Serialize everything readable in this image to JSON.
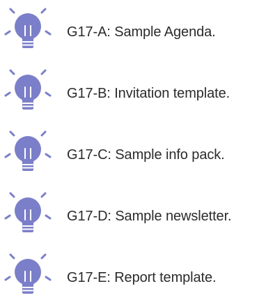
{
  "colors": {
    "bulb": "#7b7fc9",
    "bulb_base": "#7b7fc9",
    "text": "#2b2b2b"
  },
  "items": [
    {
      "icon": "lightbulb-icon",
      "label": "G17-A: Sample Agenda."
    },
    {
      "icon": "lightbulb-icon",
      "label": "G17-B: Invitation template."
    },
    {
      "icon": "lightbulb-icon",
      "label": "G17-C: Sample info pack."
    },
    {
      "icon": "lightbulb-icon",
      "label": "G17-D: Sample newsletter."
    },
    {
      "icon": "lightbulb-icon",
      "label": "G17-E: Report template."
    }
  ]
}
